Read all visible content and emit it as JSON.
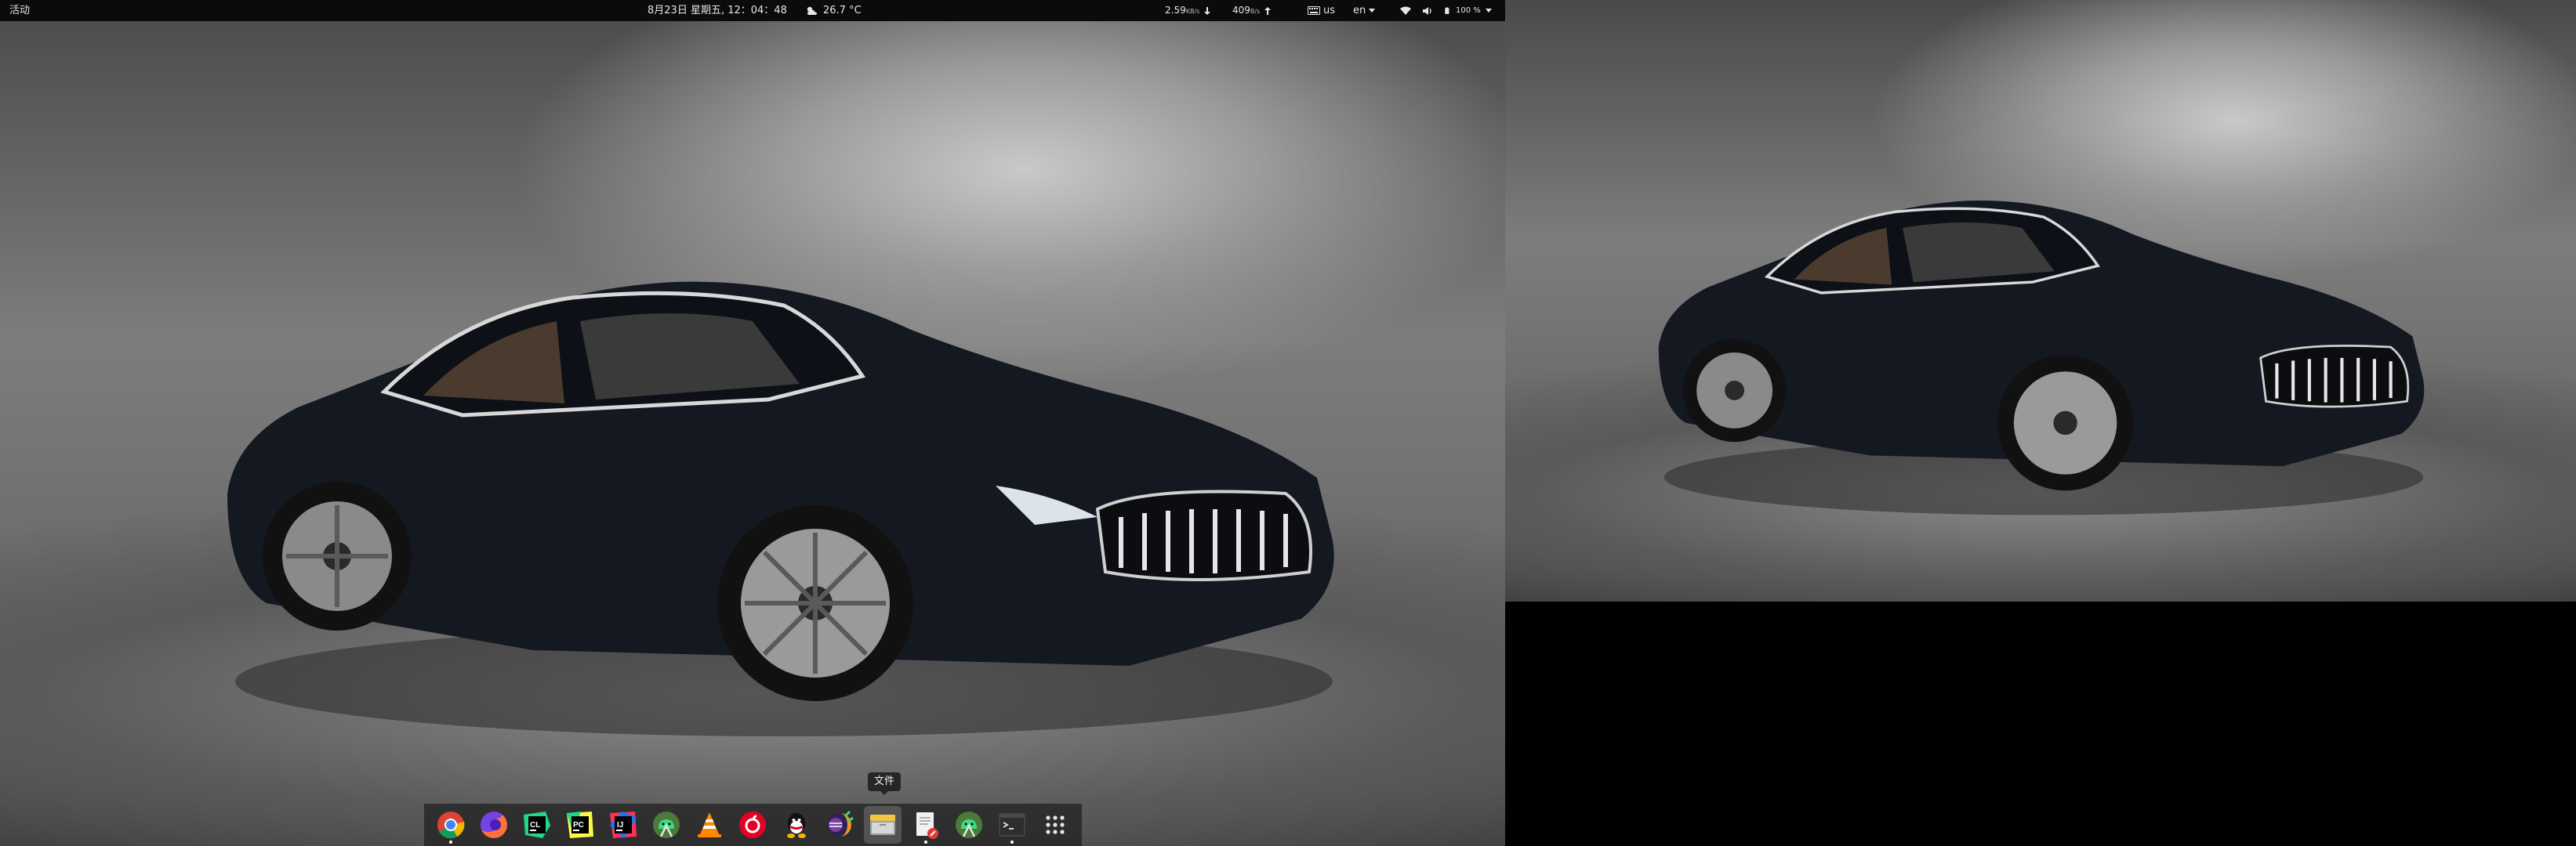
{
  "topbar": {
    "activities": "活动",
    "clock": "8月23日 星期五, 12：04：48",
    "weather": {
      "icon": "cloud-sun-icon",
      "temp": "26.7 °C"
    },
    "net_down": {
      "value": "2.59",
      "unit": "KB/s"
    },
    "net_up": {
      "value": "409",
      "unit": "B/s"
    },
    "keyboard_layout": "us",
    "input_lang": "en",
    "battery_pct": "100 %"
  },
  "dock": {
    "tooltip": "文件",
    "apps": [
      {
        "name": "Google Chrome",
        "icon": "chrome-icon",
        "color": "#4285f4",
        "running": true
      },
      {
        "name": "Firefox",
        "icon": "firefox-icon",
        "color": "#ff7139",
        "running": false
      },
      {
        "name": "CLion",
        "icon": "clion-icon",
        "color": "#21d789",
        "label": "CL",
        "running": false
      },
      {
        "name": "PyCharm",
        "icon": "pycharm-icon",
        "color": "#21d789",
        "label": "PC",
        "running": false
      },
      {
        "name": "IntelliJ IDEA",
        "icon": "intellij-icon",
        "color": "#fe315d",
        "label": "IJ",
        "running": false
      },
      {
        "name": "Android Studio",
        "icon": "android-studio-icon",
        "color": "#3ddc84",
        "running": false
      },
      {
        "name": "VLC",
        "icon": "vlc-icon",
        "color": "#ff8800",
        "running": false
      },
      {
        "name": "NetEase Cloud Music",
        "icon": "netease-music-icon",
        "color": "#e60026",
        "running": false
      },
      {
        "name": "QQ",
        "icon": "qq-icon",
        "color": "#1e1e1e",
        "running": false
      },
      {
        "name": "Eclipse",
        "icon": "eclipse-icon",
        "color": "#7b3fa0",
        "running": false
      },
      {
        "name": "Files",
        "icon": "files-icon",
        "color": "#cfcfcf",
        "running": false,
        "active": true
      },
      {
        "name": "Text Editor",
        "icon": "text-editor-icon",
        "color": "#f2f2f2",
        "running": true
      },
      {
        "name": "Android Studio",
        "icon": "android-studio-icon",
        "color": "#3ddc84",
        "running": false
      },
      {
        "name": "Terminal",
        "icon": "terminal-icon",
        "color": "#2e2e2e",
        "running": true
      },
      {
        "name": "Show Applications",
        "icon": "app-grid-icon",
        "color": "#e6e6e6",
        "running": false
      }
    ]
  }
}
